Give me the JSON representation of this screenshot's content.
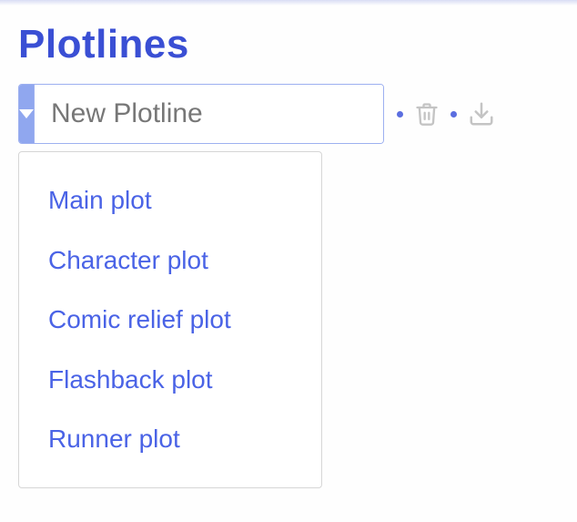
{
  "heading": "Plotlines",
  "input": {
    "placeholder": "New Plotline",
    "value": ""
  },
  "dropdown": {
    "items": [
      {
        "label": "Main plot"
      },
      {
        "label": "Character plot"
      },
      {
        "label": "Comic relief plot"
      },
      {
        "label": "Flashback plot"
      },
      {
        "label": "Runner plot"
      }
    ]
  },
  "colors": {
    "accent": "#3a4fd4",
    "dropdown_btn": "#90a7ef",
    "link": "#4a63e6",
    "icon_muted": "#c4c4c4"
  }
}
